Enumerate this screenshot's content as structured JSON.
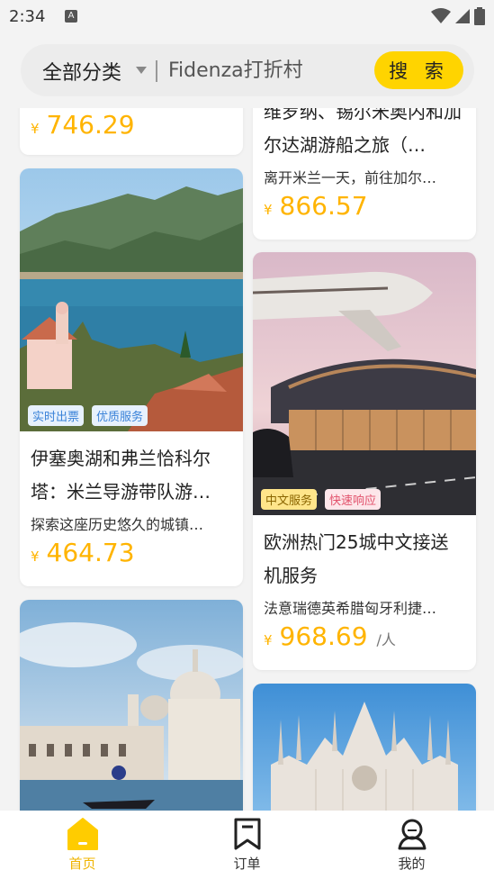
{
  "status_bar": {
    "time": "2:34",
    "sim_label": "A"
  },
  "search": {
    "category": "全部分类",
    "placeholder": "Fidenza打折村",
    "button": "搜 索"
  },
  "cards": {
    "c1": {
      "price_symbol": "¥",
      "price": "746.29"
    },
    "c2": {
      "title": "维罗纳、锡尔米奥内和加尔达湖游船之旅（…",
      "desc": "离开米兰一天，前往加尔…",
      "price_symbol": "¥",
      "price": "866.57"
    },
    "c3": {
      "tags": [
        "实时出票",
        "优质服务"
      ],
      "title": "伊塞奥湖和弗兰恰科尔塔：米兰导游带队游…",
      "desc": "探索这座历史悠久的城镇…",
      "price_symbol": "¥",
      "price": "464.73"
    },
    "c4": {
      "tags": [
        "中文服务",
        "快速响应"
      ],
      "title": "欧洲热门25城中文接送机服务",
      "desc": "法意瑞德英希腊匈牙利捷…",
      "price_symbol": "¥",
      "price": "968.69",
      "unit": "/人"
    }
  },
  "nav": {
    "items": [
      {
        "label": "首页",
        "icon": "home-icon",
        "active": true
      },
      {
        "label": "订单",
        "icon": "bookmark-icon",
        "active": false
      },
      {
        "label": "我的",
        "icon": "user-icon",
        "active": false
      }
    ]
  },
  "colors": {
    "accent": "#ffd400",
    "price": "#ffb400",
    "background": "#f3f3f3"
  }
}
